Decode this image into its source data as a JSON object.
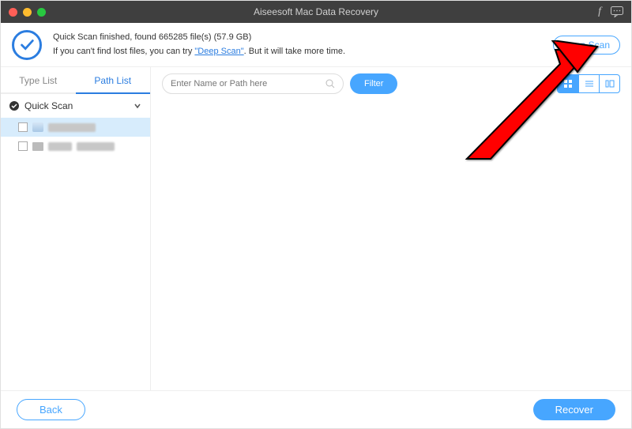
{
  "titlebar": {
    "title": "Aiseesoft Mac Data Recovery"
  },
  "info": {
    "line1": "Quick Scan finished, found 665285 file(s) (57.9 GB)",
    "line2a": "If you can't find lost files, you can try ",
    "deep_link": "\"Deep Scan\"",
    "line2b": ". But it will take more time."
  },
  "deep_scan_btn": "Deep Scan",
  "sidebar": {
    "tabs": {
      "type": "Type List",
      "path": "Path List",
      "active": "path"
    },
    "group": "Quick Scan",
    "rows": [
      {
        "selected": true
      },
      {
        "selected": false
      }
    ]
  },
  "toolbar": {
    "search_placeholder": "Enter Name or Path here",
    "filter": "Filter",
    "view": "grid"
  },
  "footer": {
    "back": "Back",
    "recover": "Recover"
  }
}
